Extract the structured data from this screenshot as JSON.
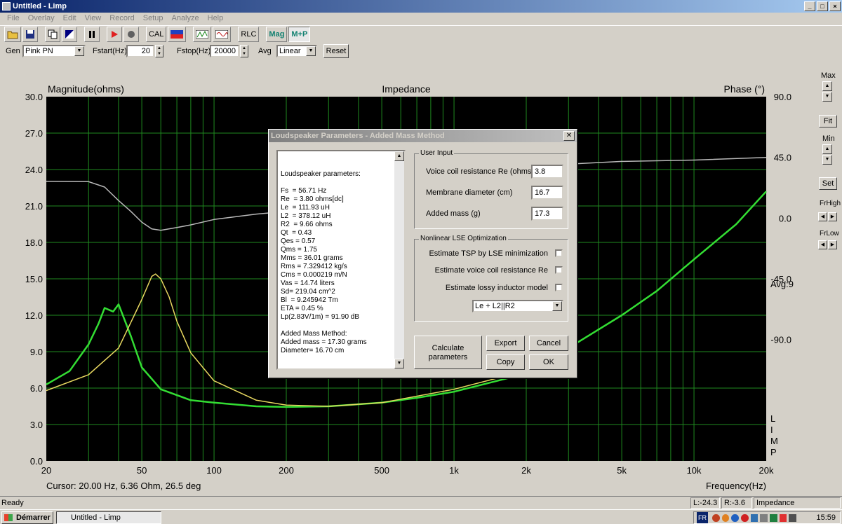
{
  "window": {
    "title": "Untitled - Limp"
  },
  "menu": [
    "File",
    "Overlay",
    "Edit",
    "View",
    "Record",
    "Setup",
    "Analyze",
    "Help"
  ],
  "toolbar": {
    "cal": "CAL",
    "rlc": "RLC",
    "mag": "Mag",
    "mp": "M+P"
  },
  "controls": {
    "gen_label": "Gen",
    "gen_value": "Pink PN",
    "fstart_label": "Fstart(Hz)",
    "fstart_value": "20",
    "fstop_label": "Fstop(Hz)",
    "fstop_value": "20000",
    "avg_label": "Avg",
    "avg_value": "Linear",
    "reset": "Reset"
  },
  "chart_data": {
    "type": "line",
    "title": "Impedance",
    "ylabel_left": "Magnitude(ohms)",
    "ylabel_right": "Phase (°)",
    "xlabel": "Frequency(Hz)",
    "xscale": "log",
    "xlim": [
      20,
      20000
    ],
    "ylim": [
      0,
      30
    ],
    "ylim_right": [
      -180,
      90
    ],
    "x_ticks": [
      "20",
      "50",
      "100",
      "200",
      "500",
      "1k",
      "2k",
      "5k",
      "10k",
      "20k"
    ],
    "x_tick_values": [
      20,
      50,
      100,
      200,
      500,
      1000,
      2000,
      5000,
      10000,
      20000
    ],
    "y_ticks_left": [
      "0.0",
      "3.0",
      "6.0",
      "9.0",
      "12.0",
      "15.0",
      "18.0",
      "21.0",
      "24.0",
      "27.0",
      "30.0"
    ],
    "y_ticks_right": [
      "-90.0",
      "-45.0",
      "0.0",
      "45.0",
      "90.0"
    ],
    "y_tick_values_right": [
      -90,
      -45,
      0,
      45,
      90
    ],
    "grid": true,
    "avg_label": "Avg:9",
    "limp_letters": [
      "L",
      "I",
      "M",
      "P"
    ],
    "cursor_text": "Cursor: 20.00 Hz, 6.36 Ohm, 26.5 deg",
    "series": [
      {
        "color": "#33dd33",
        "axis": "left",
        "x": [
          20,
          25,
          30,
          33,
          35,
          38,
          40,
          45,
          50,
          60,
          80,
          100,
          150,
          200,
          300,
          500,
          700,
          1000,
          2000,
          3000,
          5000,
          7000,
          10000,
          15000,
          20000
        ],
        "y": [
          6.3,
          7.4,
          9.6,
          11.3,
          12.6,
          12.3,
          12.9,
          10.3,
          7.7,
          5.9,
          5.0,
          4.8,
          4.5,
          4.45,
          4.5,
          4.8,
          5.2,
          5.7,
          7.2,
          9.3,
          12.0,
          14.0,
          16.6,
          19.5,
          22.2
        ]
      },
      {
        "color": "#e8d860",
        "axis": "left",
        "x": [
          20,
          30,
          40,
          50,
          55,
          57,
          60,
          65,
          70,
          80,
          100,
          150,
          200,
          300,
          500,
          1000,
          1500
        ],
        "y": [
          5.8,
          7.1,
          9.3,
          13.3,
          15.2,
          15.4,
          15.0,
          13.5,
          11.5,
          8.9,
          6.6,
          5.0,
          4.6,
          4.5,
          4.8,
          5.9,
          6.8
        ]
      },
      {
        "color": "#b8b8b8",
        "axis": "right",
        "x": [
          20,
          30,
          35,
          40,
          45,
          50,
          55,
          60,
          70,
          80,
          100,
          150,
          200,
          3000,
          5000,
          10000,
          20000
        ],
        "y": [
          27.2,
          27.0,
          23,
          13,
          5,
          -3,
          -8,
          -9,
          -7,
          -5,
          -1,
          3,
          5,
          40,
          42,
          43,
          45
        ]
      }
    ]
  },
  "side": {
    "max": "Max",
    "fit": "Fit",
    "min": "Min",
    "set": "Set",
    "frhigh": "FrHigh",
    "frlow": "FrLow"
  },
  "dialog": {
    "title": "Loudspeaker Parameters - Added Mass Method",
    "results_lines": [
      "Loudspeaker parameters:",
      "",
      "Fs  = 56.71 Hz",
      "Re  = 3.80 ohms[dc]",
      "Le  = 111.93 uH",
      "L2  = 378.12 uH",
      "R2  = 9.66 ohms",
      "Qt  = 0.43",
      "Qes = 0.57",
      "Qms = 1.75",
      "Mms = 36.01 grams",
      "Rms = 7.329412 kg/s",
      "Cms = 0.000219 m/N",
      "Vas = 14.74 liters",
      "Sd= 219.04 cm^2",
      "Bl  = 9.245942 Tm",
      "ETA = 0.45 %",
      "Lp(2.83V/1m) = 91.90 dB",
      "",
      "Added Mass Method:",
      "Added mass = 17.30 grams",
      "Diameter= 16.70 cm"
    ],
    "user_input_title": "User Input",
    "re_label": "Voice coil resistance Re (ohms)",
    "re_value": "3.8",
    "diam_label": "Membrane diameter (cm)",
    "diam_value": "16.7",
    "mass_label": "Added mass (g)",
    "mass_value": "17.3",
    "lse_title": "Nonlinear LSE Optimization",
    "chk1": "Estimate TSP by LSE minimization",
    "chk2": "Estimate voice coil resistance Re",
    "chk3": "Estimate lossy inductor model",
    "model": "Le + L2||R2",
    "calc1": "Calculate",
    "calc2": "parameters",
    "export": "Export",
    "cancel": "Cancel",
    "copy": "Copy",
    "ok": "OK"
  },
  "status": {
    "ready": "Ready",
    "l": "L:-24.3",
    "r": "R:-3.6",
    "mode": "Impedance Measurement"
  },
  "taskbar": {
    "start": "Démarrer",
    "task": "Untitled - Limp",
    "lang": "FR",
    "clock": "15:59"
  }
}
